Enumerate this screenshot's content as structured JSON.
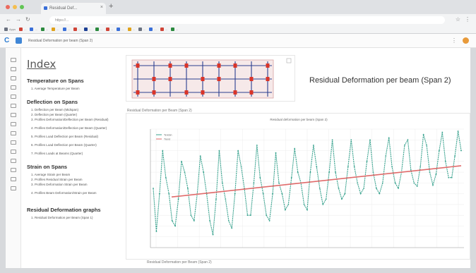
{
  "browser": {
    "tab_title": "Residual Def...",
    "tab_close": "×",
    "new_tab": "+",
    "url": "https://...",
    "nav_back": "←",
    "nav_forward": "→",
    "nav_reload": "↻",
    "menu_glyph": "⋮",
    "star_glyph": "☆",
    "bookmarks": [
      {
        "label": "Apps",
        "color": "#6b7280"
      },
      {
        "label": "...",
        "color": "#d04437"
      },
      {
        "label": "...",
        "color": "#3a6fd8"
      },
      {
        "label": "...",
        "color": "#2b8a3e"
      },
      {
        "label": "...",
        "color": "#e0a21b"
      },
      {
        "label": "...",
        "color": "#3a6fd8"
      },
      {
        "label": "...",
        "color": "#d04437"
      },
      {
        "label": "...",
        "color": "#1c3f94"
      },
      {
        "label": "...",
        "color": "#2b8a3e"
      },
      {
        "label": "...",
        "color": "#d04437"
      },
      {
        "label": "...",
        "color": "#3a6fd8"
      },
      {
        "label": "...",
        "color": "#e0a21b"
      },
      {
        "label": "...",
        "color": "#6b7280"
      },
      {
        "label": "...",
        "color": "#3a6fd8"
      },
      {
        "label": "...",
        "color": "#d04437"
      },
      {
        "label": "...",
        "color": "#2b8a3e"
      }
    ]
  },
  "app": {
    "breadcrumb": "Residual Deformation per beam (Span 2)",
    "logo_glyph": "C"
  },
  "index": {
    "title": "Index",
    "sections": [
      {
        "title": "Temperature on Spans",
        "items": [
          "1. Average Temperature per Beam"
        ]
      },
      {
        "title": "Deflection on Spans",
        "items": [
          "1. Deflection per Beam (Midspan)",
          "2. Deflection per Beam (Quarter)",
          "3. Profiles Deformation/Deflection per Beam (Residual)",
          "4. Profiles Deformation/Deflection per Beam (Quarter)",
          "5. Profiles Load Deflection per Beam (Residual)",
          "6. Profiles Load Deflection per Beam (Quarter)",
          "7. Profiles Loads at Beams (Quarter)"
        ]
      },
      {
        "title": "Strain on Spans",
        "items": [
          "1. Average Strain per Beam",
          "2. Profiles Residual Strain per Beam",
          "3. Profiles Deformation Strain per Beam",
          "4. Profiles Beam Deformation/Strain per Beam"
        ]
      },
      {
        "title": "Residual Deformation graphs",
        "items": [
          "1. Residual Deformation per Beam (Span 1)"
        ]
      }
    ]
  },
  "panel": {
    "title": "Residual Deformation per beam (Span 2)"
  },
  "chart": {
    "header": "Residual Deformation per Beam (Span 2)",
    "title": "Residual deformation per beam (Span 2)",
    "footer": "Residual Deformation per Beam (Span 2)",
    "legend": [
      "Tendon",
      "Trend"
    ],
    "colors": {
      "series": "#3aa38f",
      "trend": "#e06a6a",
      "grid": "#ececec",
      "axis": "#999999"
    }
  },
  "chart_data": {
    "type": "line",
    "title": "Residual deformation per beam (Span 2)",
    "xlabel": "",
    "ylabel": "",
    "x_tick_labels": [
      "",
      "",
      "",
      "",
      "",
      "",
      "",
      "",
      "",
      "",
      "",
      "",
      "",
      "",
      ""
    ],
    "ylim": [
      -6,
      5
    ],
    "grid": true,
    "legend_position": "top-left",
    "series": [
      {
        "name": "Tendon",
        "values": [
          -0.5,
          -4.5,
          -1,
          3,
          0.5,
          -1,
          -3.5,
          -4,
          -1.5,
          2,
          1,
          -0.5,
          -3,
          -3.5,
          -1,
          2.5,
          1,
          -1,
          -3.5,
          -4.8,
          -1.5,
          3,
          0,
          -1.5,
          -3.5,
          -4.2,
          -1,
          3,
          1.5,
          -0.5,
          -3,
          -3,
          0,
          3.5,
          0.5,
          -1,
          -3,
          -3.5,
          -1,
          2.8,
          0,
          -1,
          -2.5,
          -2,
          0.5,
          3.2,
          1,
          0,
          -2,
          -2.5,
          1,
          3.5,
          1.5,
          -0.5,
          -2,
          -1.5,
          1,
          4,
          1,
          -0.5,
          -1.5,
          -1,
          1.5,
          4,
          1.5,
          0,
          -1,
          -0.5,
          2,
          4,
          1,
          -0.5,
          -1,
          0,
          2.5,
          4.2,
          1.5,
          0,
          -0.5,
          1,
          3.5,
          4,
          1.2,
          0,
          -0.3,
          1.5,
          4.5,
          3.5,
          1,
          -0.2,
          0.8,
          3,
          4.7,
          2,
          0.5,
          0.5,
          2.5,
          4.8,
          3
        ]
      },
      {
        "name": "Trend",
        "values": [
          -1.3,
          1.6
        ]
      }
    ]
  }
}
